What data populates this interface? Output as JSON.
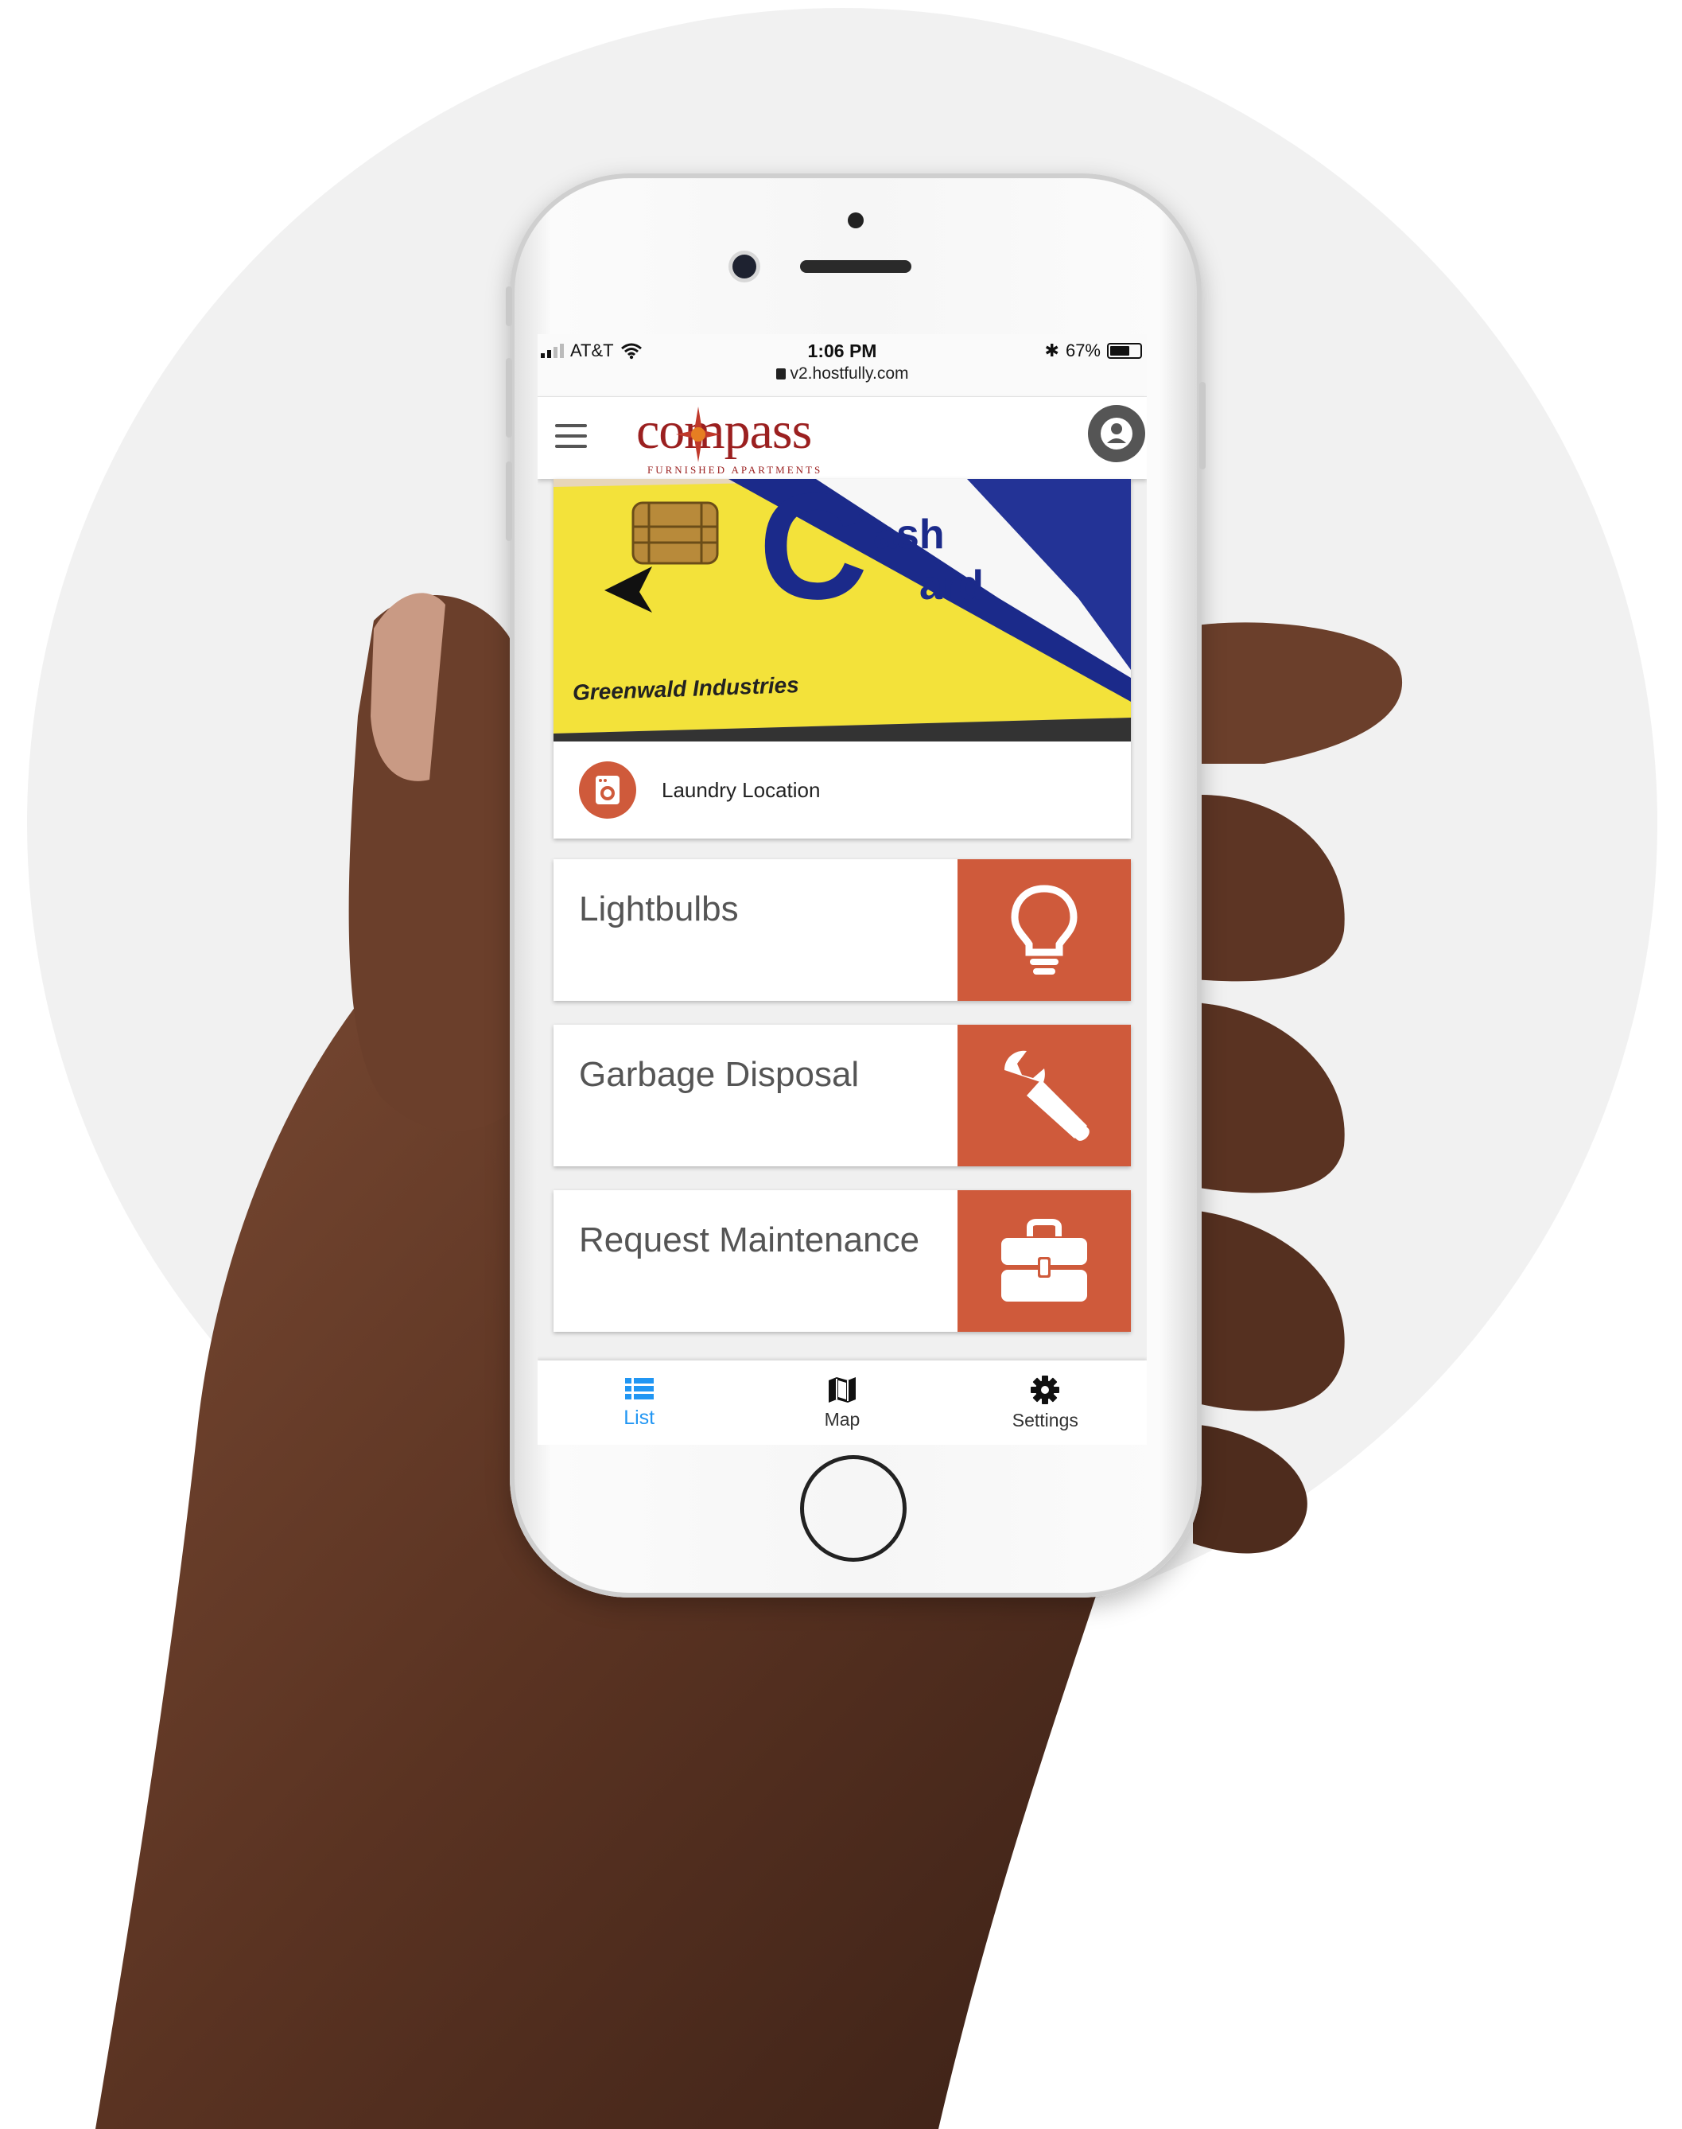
{
  "status_bar": {
    "carrier": "AT&T",
    "time": "1:06 PM",
    "url": "v2.hostfully.com",
    "battery_text": "67%",
    "battery_level": 0.67
  },
  "app_bar": {
    "logo_text": "compass",
    "logo_tagline": "FURNISHED APARTMENTS",
    "menu_icon": "hamburger-menu-icon",
    "account_icon": "account-circle-icon"
  },
  "featured_card": {
    "image_text_1": "ash",
    "image_text_2": "ard",
    "image_caption": "Greenwald Industries",
    "label": "Laundry Location",
    "icon": "washing-machine-icon"
  },
  "tiles": [
    {
      "label": "Lightbulbs",
      "icon": "lightbulb-icon"
    },
    {
      "label": "Garbage Disposal",
      "icon": "wrench-icon"
    },
    {
      "label": "Request Maintenance",
      "icon": "toolbox-icon"
    }
  ],
  "bottom_nav": [
    {
      "label": "List",
      "icon": "list-icon",
      "active": true
    },
    {
      "label": "Map",
      "icon": "map-icon",
      "active": false
    },
    {
      "label": "Settings",
      "icon": "gear-icon",
      "active": false
    }
  ],
  "colors": {
    "accent": "#cf5a3b",
    "active_nav": "#2196f3",
    "logo": "#9b2020"
  }
}
